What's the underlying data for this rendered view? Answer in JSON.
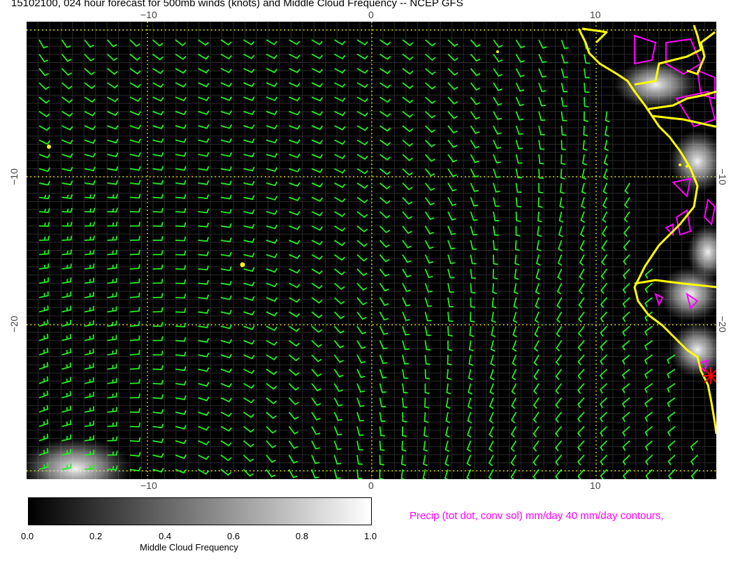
{
  "title": "15102100, 024 hour forecast for 500mb winds (knots) and Middle Cloud Frequency -- NCEP GFS",
  "axes": {
    "lon_ticks": [
      "−10",
      "0",
      "10"
    ],
    "lat_ticks": [
      "−10",
      "−20"
    ],
    "lon_range": [
      -15.3,
      15.3
    ],
    "lat_range": [
      -29.5,
      -1.5
    ]
  },
  "colorbar": {
    "label": "Middle Cloud Frequency",
    "ticks": [
      "0.0",
      "0.2",
      "0.4",
      "0.6",
      "0.8",
      "1.0"
    ],
    "range": [
      0.0,
      1.0
    ],
    "colors": [
      "#000000",
      "#ffffff"
    ]
  },
  "precip_label": "Precip (tot dot, conv sol) mm/day 40 mm/day contours,",
  "colors": {
    "background": "#000000",
    "wind_barbs": "#22ee22",
    "coastline": "#ffff00",
    "precip_contours": "#ff00ff",
    "grid": "#ffff00",
    "marker": "#ff0000"
  },
  "layers": [
    "wind-barbs",
    "middle-cloud-frequency",
    "precip-contours",
    "coastline"
  ]
}
